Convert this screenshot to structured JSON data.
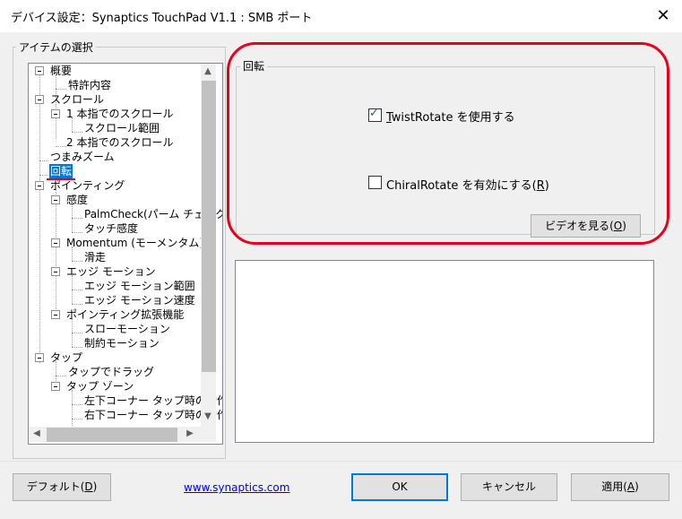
{
  "window": {
    "title": "デバイス設定：Synaptics TouchPad V1.1 : SMB ポート",
    "close_label": "✕"
  },
  "left_group": {
    "label": "アイテムの選択"
  },
  "tree": {
    "items": [
      {
        "label": "概要"
      },
      {
        "label": "特許内容"
      },
      {
        "label": "スクロール"
      },
      {
        "label": "1 本指でのスクロール"
      },
      {
        "label": "スクロール範囲"
      },
      {
        "label": "2 本指でのスクロール"
      },
      {
        "label": "つまみズーム"
      },
      {
        "label": "回転"
      },
      {
        "label": "ポインティング"
      },
      {
        "label": "感度"
      },
      {
        "label": "PalmCheck(パーム チェック)"
      },
      {
        "label": "タッチ感度"
      },
      {
        "label": "Momentum (モーメンタム)"
      },
      {
        "label": "滑走"
      },
      {
        "label": "エッジ モーション"
      },
      {
        "label": "エッジ モーション範囲"
      },
      {
        "label": "エッジ モーション速度"
      },
      {
        "label": "ポインティング拡張機能"
      },
      {
        "label": "スローモーション"
      },
      {
        "label": "制約モーション"
      },
      {
        "label": "タップ"
      },
      {
        "label": "タップでドラッグ"
      },
      {
        "label": "タップ ゾーン"
      },
      {
        "label": "左下コーナー タップ時の動作"
      },
      {
        "label": "右下コーナー タップ時の動作"
      }
    ],
    "selected": "回転"
  },
  "rotate_group": {
    "label": "回転",
    "twist": {
      "prefix": "T",
      "label": "wistRotate を使用する",
      "checked": true
    },
    "chiral": {
      "label": "ChiralRotate を有効にする(",
      "mnemonic": "R",
      "suffix": ")",
      "checked": false
    },
    "video_button": {
      "label": "ビデオを見る(",
      "mnemonic": "O",
      "suffix": ")"
    }
  },
  "footer": {
    "default_button": {
      "label": "デフォルト(",
      "mnemonic": "D",
      "suffix": ")"
    },
    "link": "www.synaptics.com",
    "ok_button": "OK",
    "cancel_button": "キャンセル",
    "apply_button": {
      "label": "適用(",
      "mnemonic": "A",
      "suffix": ")"
    }
  },
  "colors": {
    "selection": "#0078d7",
    "highlight_red": "#e8001c",
    "link": "#0000ee"
  }
}
